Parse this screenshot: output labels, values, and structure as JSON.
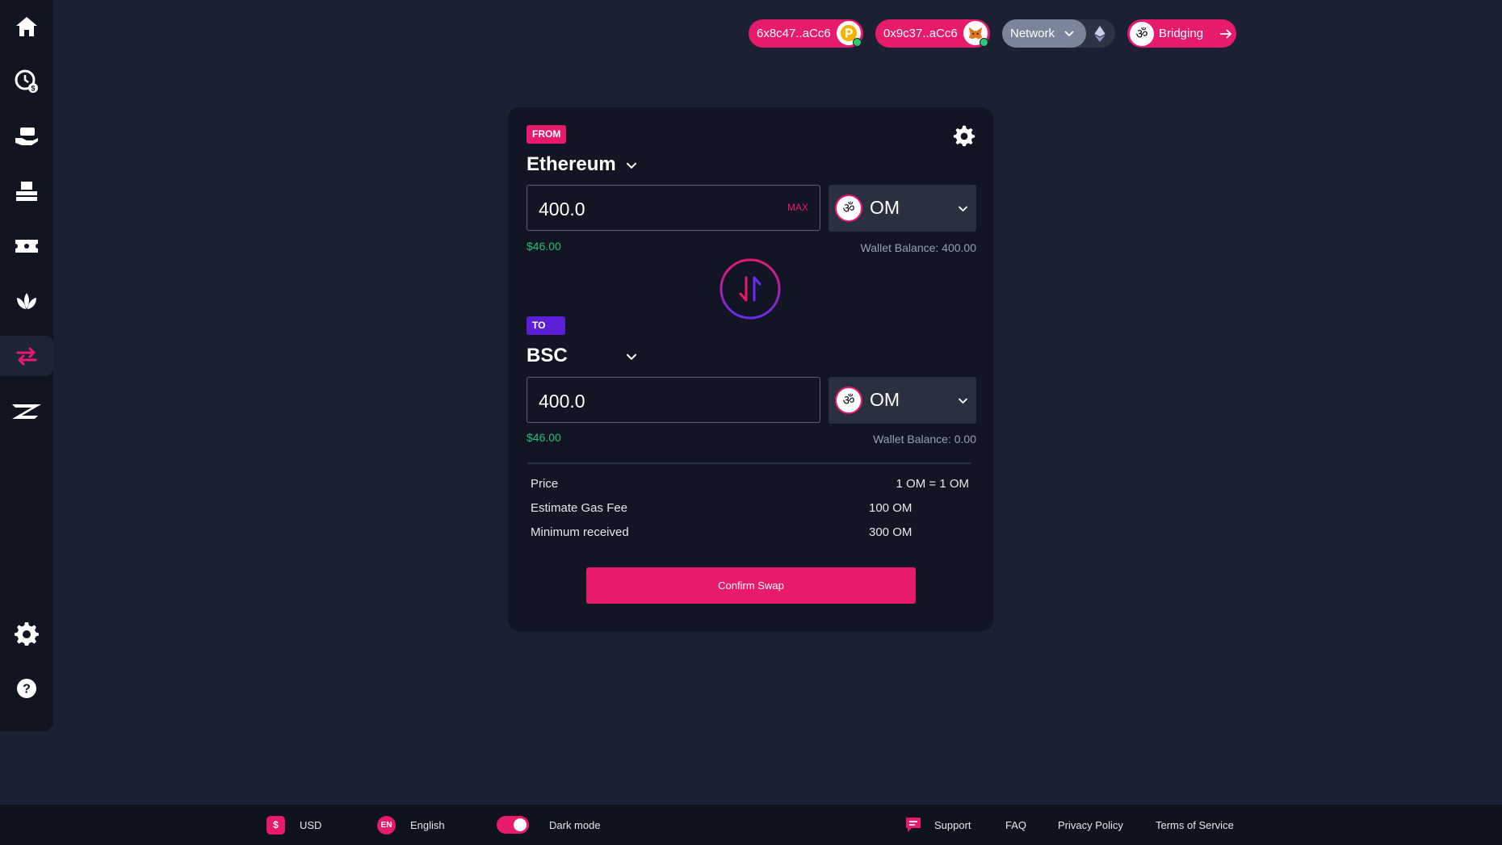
{
  "header": {
    "wallet1": {
      "address": "6x8c47..aCc6"
    },
    "wallet2": {
      "address": "0x9c37..aCc6"
    },
    "network": {
      "label": "Network"
    },
    "bridging": {
      "label": "Bridging"
    }
  },
  "sidebar": {
    "items": [
      {
        "icon": "home-icon"
      },
      {
        "icon": "staking-clock-icon"
      },
      {
        "icon": "hand-money-icon"
      },
      {
        "icon": "stack-icon"
      },
      {
        "icon": "ticket-icon"
      },
      {
        "icon": "lotus-icon"
      },
      {
        "icon": "swap-arrows-icon",
        "active": true
      },
      {
        "icon": "z-logo-icon"
      },
      {
        "icon": "settings-gear-icon"
      },
      {
        "icon": "help-icon"
      }
    ]
  },
  "swap": {
    "from": {
      "tag": "FROM",
      "chain": "Ethereum",
      "amount": "400.0",
      "max_label": "MAX",
      "token": "OM",
      "usd_value": "$46.00",
      "wallet_balance": "Wallet Balance: 400.00"
    },
    "to": {
      "tag": "TO",
      "chain": "BSC",
      "amount": "400.0",
      "token": "OM",
      "usd_value": "$46.00",
      "wallet_balance": "Wallet Balance: 0.00"
    },
    "details": {
      "price_label": "Price",
      "price_value": "1 OM = 1 OM",
      "gas_label": "Estimate Gas Fee",
      "gas_value": "100 OM",
      "min_label": "Minimum received",
      "min_value": "300 OM"
    },
    "confirm_label": "Confirm Swap"
  },
  "footer": {
    "currency": "USD",
    "currency_icon": "$",
    "language": "English",
    "language_icon": "EN",
    "dark_mode_label": "Dark mode",
    "dark_mode_on": true,
    "support": "Support",
    "faq": "FAQ",
    "privacy": "Privacy Policy",
    "terms": "Terms of Service"
  },
  "colors": {
    "accent": "#e81a6b",
    "purple": "#5b1fd6",
    "background": "#1b2132",
    "card": "#121624",
    "positive": "#21c07a"
  }
}
